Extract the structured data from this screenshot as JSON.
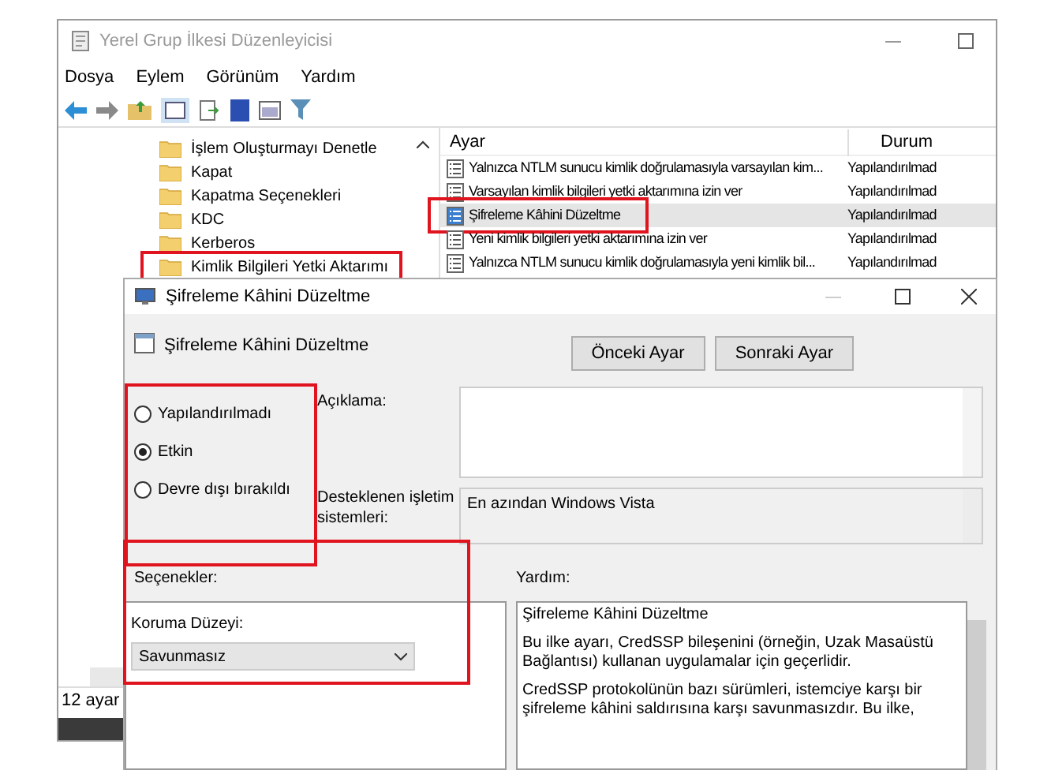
{
  "main_window": {
    "title": "Yerel Grup İlkesi Düzenleyicisi",
    "menu": [
      "Dosya",
      "Eylem",
      "Görünüm",
      "Yardım"
    ],
    "tree": {
      "items": [
        {
          "label": "İşlem Oluşturmayı Denetle",
          "annotated": false
        },
        {
          "label": "Kapat",
          "annotated": false
        },
        {
          "label": "Kapatma Seçenekleri",
          "annotated": false
        },
        {
          "label": "KDC",
          "annotated": false
        },
        {
          "label": "Kerberos",
          "annotated": false
        },
        {
          "label": "Kimlik Bilgileri Yetki Aktarımı",
          "annotated": true
        }
      ]
    },
    "list": {
      "columns": [
        "Ayar",
        "Durum"
      ],
      "rows": [
        {
          "name": "Yalnızca NTLM sunucu kimlik doğrulamasıyla varsayılan kim...",
          "status": "Yapılandırılmad",
          "selected": false,
          "annotated": false
        },
        {
          "name": "Varsayılan kimlik bilgileri yetki aktarımına izin ver",
          "status": "Yapılandırılmad",
          "selected": false,
          "annotated": false
        },
        {
          "name": "Şifreleme Kâhini Düzeltme",
          "status": "Yapılandırılmad",
          "selected": true,
          "annotated": true
        },
        {
          "name": "Yeni kimlik bilgileri yetki aktarımına izin ver",
          "status": "Yapılandırılmad",
          "selected": false,
          "annotated": false
        },
        {
          "name": "Yalnızca NTLM sunucu kimlik doğrulamasıyla yeni kimlik bil...",
          "status": "Yapılandırılmad",
          "selected": false,
          "annotated": false
        }
      ]
    },
    "status_bar": "12 ayar"
  },
  "dialog": {
    "title": "Şifreleme Kâhini Düzeltme",
    "header": "Şifreleme Kâhini Düzeltme",
    "buttons": [
      "Önceki Ayar",
      "Sonraki Ayar"
    ],
    "radios": {
      "annotated": true,
      "items": [
        {
          "label": "Yapılandırılmadı",
          "selected": false
        },
        {
          "label": "Etkin",
          "selected": true
        },
        {
          "label": "Devre dışı bırakıldı",
          "selected": false
        }
      ]
    },
    "description_label": "Açıklama:",
    "supported_label": "Desteklenen işletim sistemleri:",
    "supported_value": "En azından Windows Vista",
    "options_label": "Seçenekler:",
    "help_label": "Yardım:",
    "options": {
      "annotated": true,
      "field_label": "Koruma Düzeyi:",
      "dropdown_value": "Savunmasız"
    },
    "help_paragraphs": [
      "Şifreleme Kâhini Düzeltme",
      "Bu ilke ayarı, CredSSP bileşenini (örneğin, Uzak Masaüstü Bağlantısı) kullanan uygulamalar için geçerlidir.",
      "CredSSP protokolünün bazı sürümleri, istemciye karşı bir şifreleme kâhini saldırısına karşı savunmasızdır. Bu ilke,"
    ]
  }
}
